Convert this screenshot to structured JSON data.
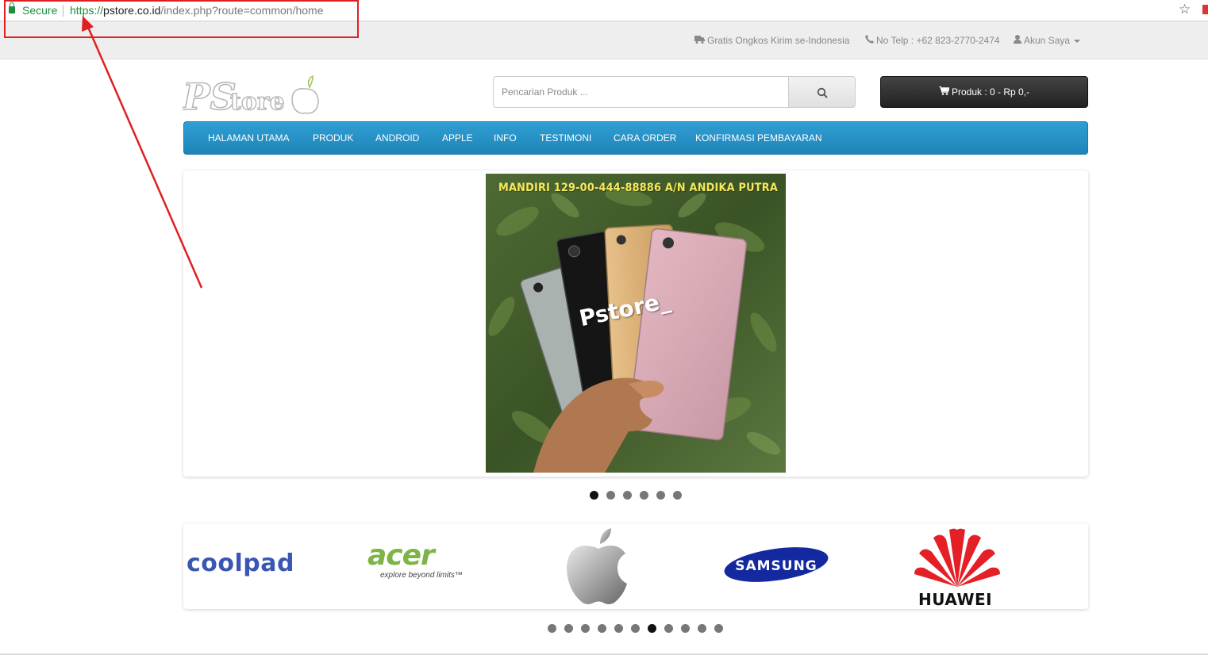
{
  "browser": {
    "secure_label": "Secure",
    "url_scheme": "https://",
    "url_host": "pstore.co.id",
    "url_path": "/index.php?route=common/home"
  },
  "topbar": {
    "shipping": "Gratis Ongkos Kirim se-Indonesia",
    "phone": "No Telp : +62 823-2770-2474",
    "account": "Akun Saya"
  },
  "header": {
    "logo_alt": "PStore",
    "search_placeholder": "Pencarian Produk ...",
    "cart_label": "Produk : 0 - Rp 0,-"
  },
  "nav": {
    "items": [
      "HALAMAN UTAMA",
      "PRODUK",
      "ANDROID",
      "APPLE",
      "INFO",
      "TESTIMONI",
      "CARA ORDER",
      "KONFIRMASI PEMBAYARAN"
    ]
  },
  "slider": {
    "banner_text": "MANDIRI 129-00-444-88886 A/N ANDIKA PUTRA",
    "watermark": "Pstore_",
    "dot_count": 6,
    "active_index": 0
  },
  "brands": {
    "items": [
      "coolpad",
      "acer",
      "Apple",
      "SAMSUNG",
      "HUAWEI"
    ],
    "acer_tagline": "explore beyond limits™",
    "dot_count": 11,
    "active_index": 6
  },
  "colors": {
    "nav_blue": "#2891c8",
    "annotation_red": "#e02020",
    "secure_green": "#1e8e3e"
  }
}
